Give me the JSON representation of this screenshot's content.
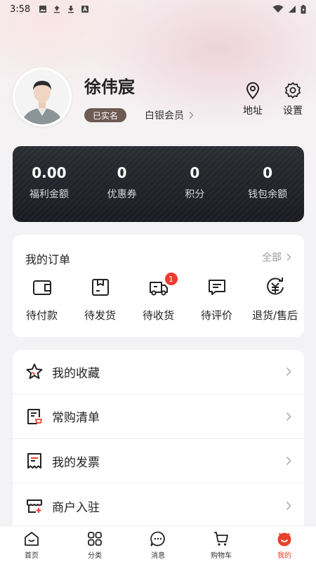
{
  "status_bar": {
    "time": "3:58"
  },
  "profile": {
    "name": "徐伟宸",
    "verified_label": "已实名",
    "member_level": "白银会员",
    "actions": [
      {
        "label": "地址",
        "icon": "location-pin-icon"
      },
      {
        "label": "设置",
        "icon": "gear-icon"
      }
    ]
  },
  "assets": [
    {
      "value": "0.00",
      "label": "福利金额"
    },
    {
      "value": "0",
      "label": "优惠券"
    },
    {
      "value": "0",
      "label": "积分"
    },
    {
      "value": "0",
      "label": "钱包余额"
    }
  ],
  "orders": {
    "title": "我的订单",
    "all_label": "全部",
    "items": [
      {
        "label": "待付款",
        "icon": "wallet-icon"
      },
      {
        "label": "待发货",
        "icon": "package-icon"
      },
      {
        "label": "待收货",
        "icon": "truck-icon",
        "badge": "1"
      },
      {
        "label": "待评价",
        "icon": "comment-icon"
      },
      {
        "label": "退货/售后",
        "icon": "refund-icon"
      }
    ]
  },
  "menu": [
    {
      "label": "我的收藏",
      "icon": "star-icon"
    },
    {
      "label": "常购清单",
      "icon": "list-icon"
    },
    {
      "label": "我的发票",
      "icon": "invoice-icon"
    },
    {
      "label": "商户入驻",
      "icon": "store-icon"
    }
  ],
  "tabbar": [
    {
      "label": "首页",
      "icon": "home-icon"
    },
    {
      "label": "分类",
      "icon": "grid-icon"
    },
    {
      "label": "消息",
      "icon": "message-icon"
    },
    {
      "label": "购物车",
      "icon": "cart-icon"
    },
    {
      "label": "我的",
      "icon": "profile-icon",
      "active": true
    }
  ],
  "colors": {
    "accent": "#e8402b",
    "badge_bg": "#6d5a53",
    "card_dark": "#1f2025"
  }
}
